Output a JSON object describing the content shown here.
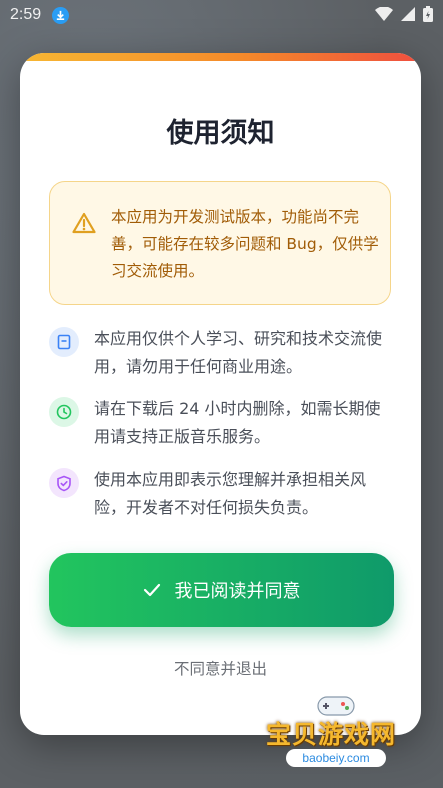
{
  "status_bar": {
    "time": "2:59"
  },
  "dialog": {
    "title": "使用须知",
    "warning": "本应用为开发测试版本，功能尚不完善，可能存在较多问题和 Bug，仅供学习交流使用。",
    "items": [
      {
        "icon": "document-icon",
        "text": "本应用仅供个人学习、研究和技术交流使用，请勿用于任何商业用途。",
        "color": "#3b82f6"
      },
      {
        "icon": "clock-icon",
        "text": "请在下载后 24 小时内删除，如需长期使用请支持正版音乐服务。",
        "color": "#22c55e"
      },
      {
        "icon": "shield-check-icon",
        "text": "使用本应用即表示您理解并承担相关风险，开发者不对任何损失负责。",
        "color": "#a855f7"
      }
    ],
    "agree_label": "我已阅读并同意",
    "decline_label": "不同意并退出"
  },
  "watermark": {
    "title": "宝贝游戏网",
    "url": "baobeiy.com"
  },
  "colors": {
    "accent_green": "#22c55e",
    "warning_text": "#a15c07",
    "warning_bg": "#fff8e6"
  }
}
